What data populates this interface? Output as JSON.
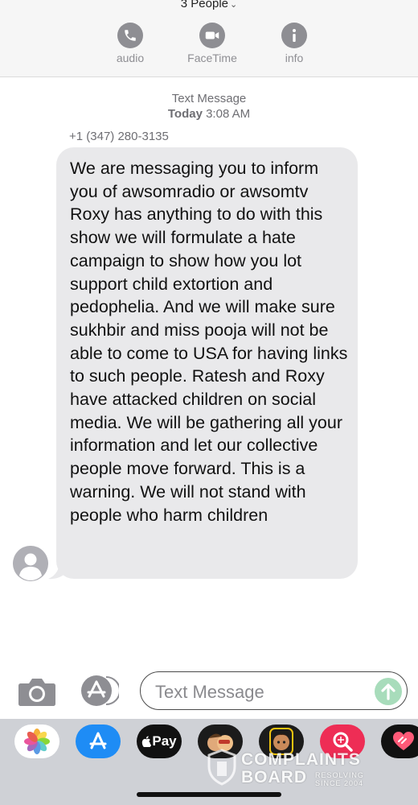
{
  "header": {
    "conversation_title": "3 People",
    "actions": [
      {
        "label": "audio",
        "icon": "phone-icon"
      },
      {
        "label": "FaceTime",
        "icon": "video-camera-icon"
      },
      {
        "label": "info",
        "icon": "info-icon"
      }
    ]
  },
  "thread": {
    "service": "Text Message",
    "date_label": "Today",
    "time": "3:08 AM",
    "sender": "+1 (347) 280-3135",
    "message": "We are messaging you to inform you of awsomradio or awsomtv Roxy has anything to do with this show we will formulate a hate campaign to show how you lot support child extortion and pedophelia. And we will make sure sukhbir and miss pooja will not be able to come to USA for having links to such people. Ratesh and Roxy have attacked children on social media. We will be gathering all your information and let our collective people move forward. This is a warning. We will not stand with people who harm children"
  },
  "composer": {
    "placeholder": "Text Message",
    "camera_icon": "camera-icon",
    "apps_icon": "app-store-icon",
    "send_icon": "send-arrow-icon"
  },
  "app_drawer": {
    "apps": [
      {
        "name": "photos-icon"
      },
      {
        "name": "app-store-icon"
      },
      {
        "name": "apple-pay-icon",
        "label": "Pay"
      },
      {
        "name": "memoji-icon"
      },
      {
        "name": "memoji-stickers-icon"
      },
      {
        "name": "image-search-icon"
      },
      {
        "name": "digital-touch-icon"
      }
    ]
  },
  "watermark": {
    "line1": "COMPLAINTS",
    "line2": "BOARD",
    "tag1": "RESOLVING",
    "tag2": "SINCE 2004"
  },
  "colors": {
    "bubble": "#e9e9eb",
    "meta_text": "#6e6e73",
    "action_grey": "#8e8e93",
    "send_green": "#a8dcbb",
    "drawer": "#cfd1d6"
  }
}
